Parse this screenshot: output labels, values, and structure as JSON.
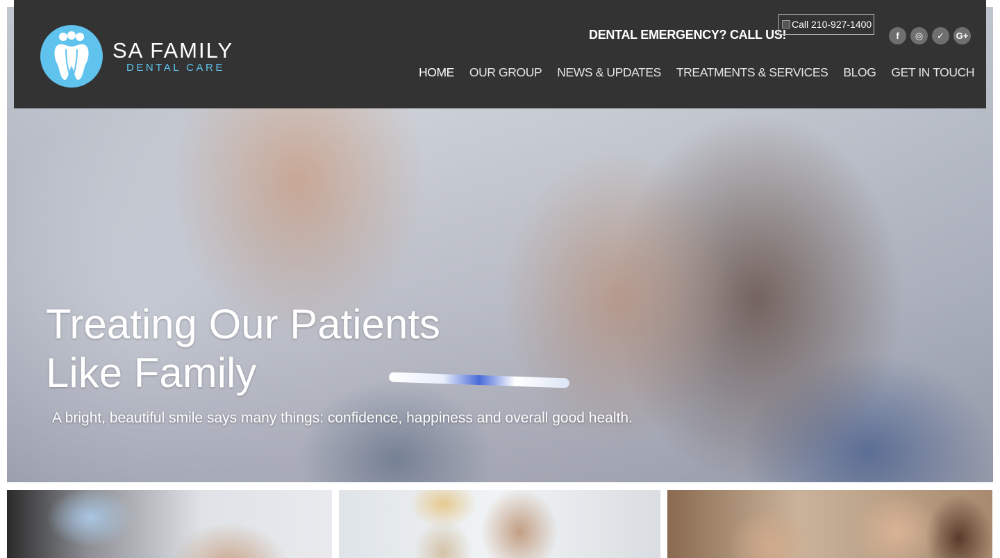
{
  "brand": {
    "name": "SA FAMILY",
    "tagline": "DENTAL CARE",
    "logo_icon": "tooth-family-icon",
    "primary_color": "#5fc3ee",
    "header_bg": "#333333"
  },
  "header": {
    "emergency_text": "DENTAL EMERGENCY? CALL US!",
    "call_button_label": "Call 210-927-1400",
    "social": [
      {
        "icon": "facebook-icon",
        "glyph": "f"
      },
      {
        "icon": "instagram-icon",
        "glyph": "◎"
      },
      {
        "icon": "twitter-icon",
        "glyph": "✓"
      },
      {
        "icon": "google-plus-icon",
        "glyph": "G+"
      }
    ]
  },
  "nav": {
    "items": [
      {
        "label": "HOME",
        "active": true
      },
      {
        "label": "OUR GROUP"
      },
      {
        "label": "NEWS & UPDATES"
      },
      {
        "label": "TREATMENTS & SERVICES"
      },
      {
        "label": "BLOG"
      },
      {
        "label": "GET IN TOUCH"
      }
    ]
  },
  "hero": {
    "title_line1": "Treating Our Patients",
    "title_line2": "Like Family",
    "subtitle": "A bright, beautiful smile says many things: confidence, happiness and overall good health."
  }
}
